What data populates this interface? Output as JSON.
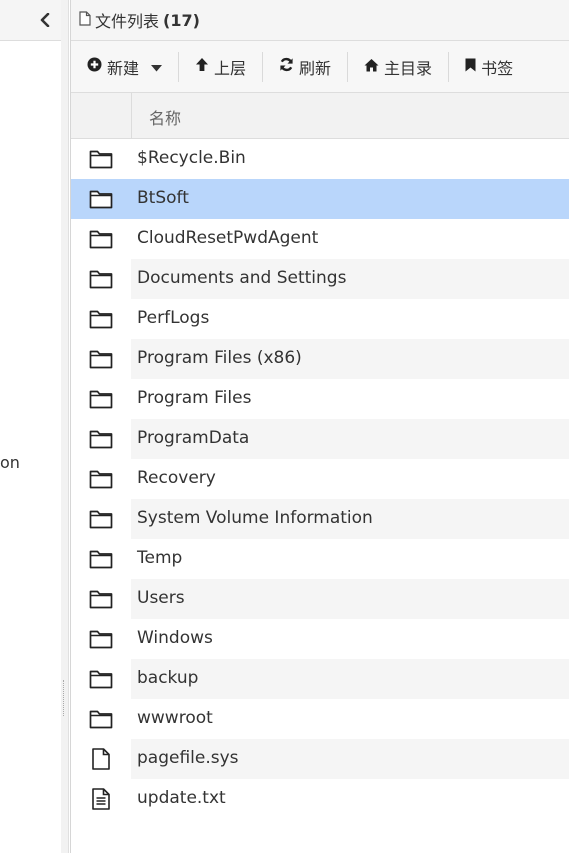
{
  "left_panel": {
    "partial_text": "on"
  },
  "panel_header": {
    "title": "文件列表",
    "count": "(17)"
  },
  "toolbar": {
    "new_label": "新建",
    "up_label": "上层",
    "refresh_label": "刷新",
    "home_label": "主目录",
    "bookmark_label": "书签"
  },
  "columns": {
    "name": "名称"
  },
  "files": [
    {
      "name": "$Recycle.Bin",
      "type": "folder"
    },
    {
      "name": "BtSoft",
      "type": "folder",
      "selected": true
    },
    {
      "name": "CloudResetPwdAgent",
      "type": "folder"
    },
    {
      "name": "Documents and Settings",
      "type": "folder"
    },
    {
      "name": "PerfLogs",
      "type": "folder"
    },
    {
      "name": "Program Files (x86)",
      "type": "folder"
    },
    {
      "name": "Program Files",
      "type": "folder"
    },
    {
      "name": "ProgramData",
      "type": "folder"
    },
    {
      "name": "Recovery",
      "type": "folder"
    },
    {
      "name": "System Volume Information",
      "type": "folder"
    },
    {
      "name": "Temp",
      "type": "folder"
    },
    {
      "name": "Users",
      "type": "folder"
    },
    {
      "name": "Windows",
      "type": "folder"
    },
    {
      "name": "backup",
      "type": "folder"
    },
    {
      "name": "wwwroot",
      "type": "folder"
    },
    {
      "name": "pagefile.sys",
      "type": "file"
    },
    {
      "name": "update.txt",
      "type": "text-file"
    }
  ],
  "colors": {
    "selected_row": "#b9d6fb",
    "stripe_row": "#f5f5f5"
  }
}
